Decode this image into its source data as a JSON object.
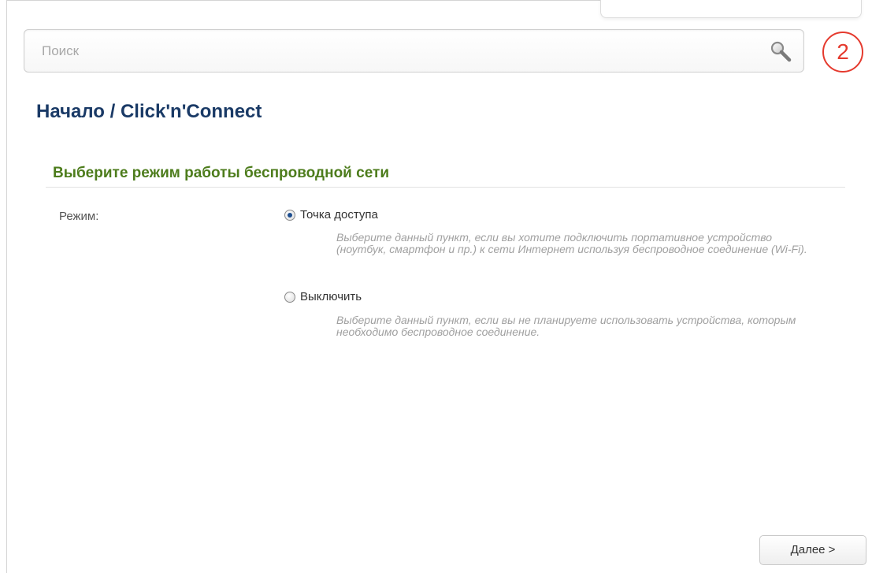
{
  "search": {
    "placeholder": "Поиск",
    "value": ""
  },
  "marker": {
    "number": "2"
  },
  "breadcrumb": {
    "text": "Начало /  Click'n'Connect"
  },
  "section": {
    "title": "Выберите режим работы беспроводной сети"
  },
  "mode": {
    "label": "Режим:",
    "options": [
      {
        "label": "Точка доступа",
        "checked": true,
        "hint": "Выберите данный пункт, если вы хотите подключить портативное устройство (ноутбук, смартфон и пр.) к сети Интернет используя беспроводное соединение (Wi-Fi)."
      },
      {
        "label": "Выключить",
        "checked": false,
        "hint": "Выберите данный пункт, если вы не планируете использовать устройства, которым необходимо беспроводное соединение."
      }
    ]
  },
  "footer": {
    "next_label": "Далее >"
  },
  "colors": {
    "breadcrumb": "#1a3a66",
    "section_title": "#4d7c1c",
    "marker": "#e53a2e",
    "hint": "#a0a0a0"
  },
  "icons": {
    "search": "search-icon",
    "radio_checked": "radio-checked-icon",
    "radio_unchecked": "radio-unchecked-icon"
  }
}
